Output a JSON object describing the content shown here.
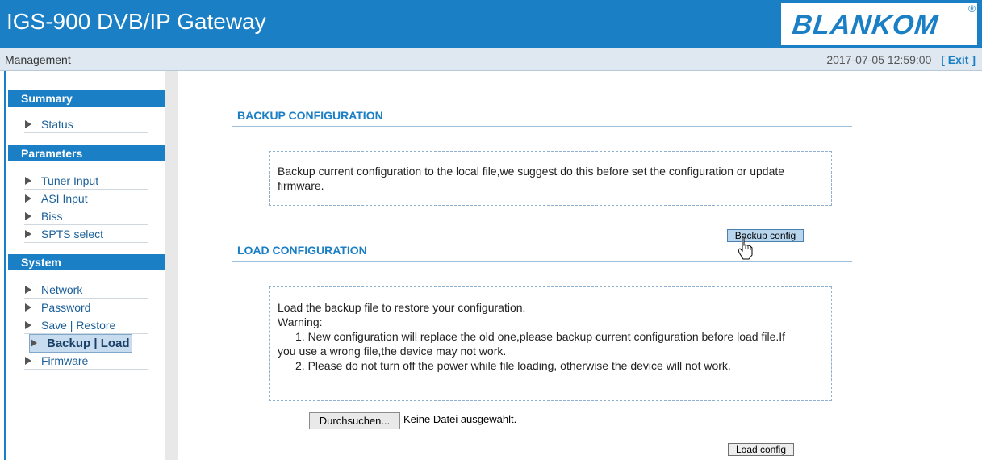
{
  "header": {
    "title": "IGS-900 DVB/IP Gateway",
    "logo": "BLANKOM",
    "logo_mark": "®"
  },
  "topbar": {
    "left_text": "Management",
    "datetime": "2017-07-05 12:59:00",
    "exit_label": "[ Exit ]"
  },
  "sidebar": {
    "summary": {
      "title": "Summary",
      "items": [
        "Status"
      ]
    },
    "parameters": {
      "title": "Parameters",
      "items": [
        "Tuner Input",
        "ASI Input",
        "Biss",
        "SPTS select"
      ]
    },
    "system": {
      "title": "System",
      "items": [
        "Network",
        "Password",
        "Save | Restore",
        "Backup | Load",
        "Firmware"
      ]
    },
    "active_item": "Backup | Load"
  },
  "backup": {
    "title": "BACKUP CONFIGURATION",
    "description_line1": "Backup current configuration to the local file,we suggest do this before set the configuration or update",
    "description_line2": "firmware.",
    "button": "Backup config"
  },
  "load": {
    "title": "LOAD CONFIGURATION",
    "intro": "Load the backup file to restore your configuration.",
    "warning_label": "Warning:",
    "warning1_line1": "1. New configuration will replace the old one,please backup current configuration before load file.If",
    "warning1_line2": "you use a wrong file,the device may not work.",
    "warning2": "2. Please do not turn off the power while file loading, otherwise the device will not work.",
    "browse_button": "Durchsuchen...",
    "no_file": "Keine Datei ausgewählt.",
    "load_button": "Load config"
  },
  "colors": {
    "brand_blue": "#1a7fc4",
    "topbar_bg": "#dfe8f1",
    "active_bg": "#c8dcef"
  },
  "icons": [
    "menu-arrow-icon",
    "hand-pointer-icon"
  ]
}
